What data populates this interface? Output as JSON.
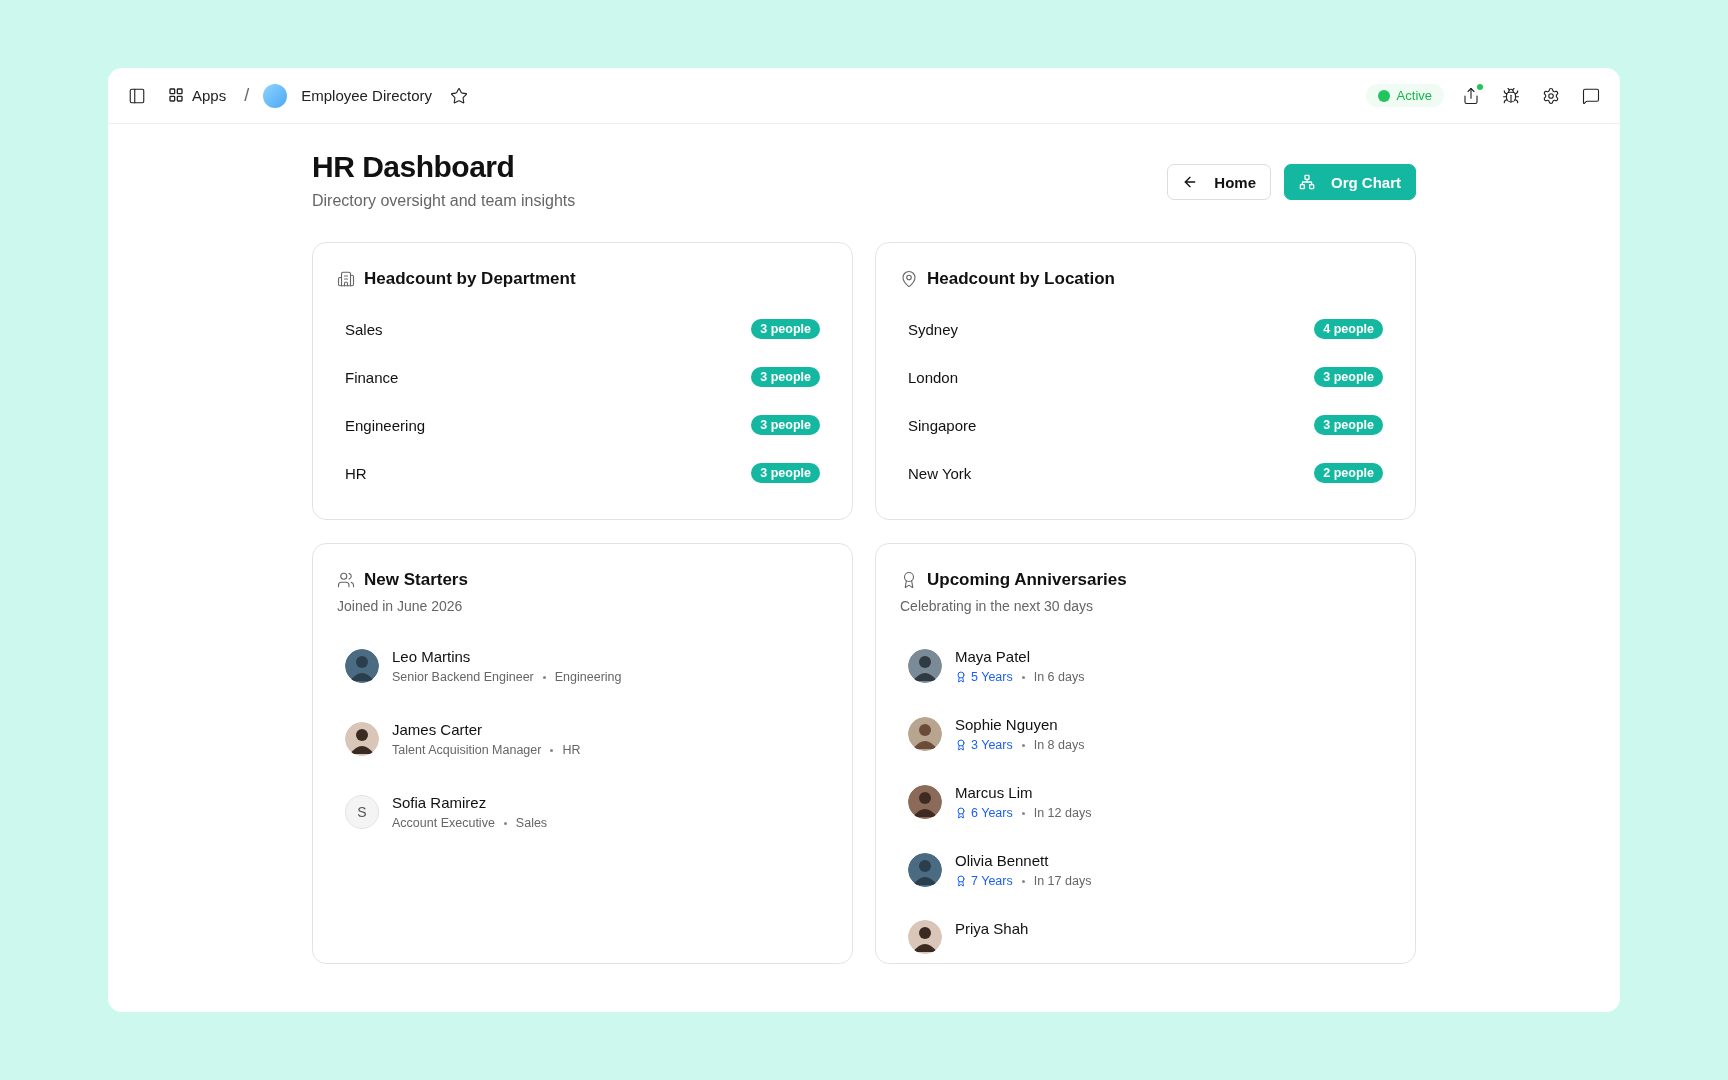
{
  "topbar": {
    "apps_label": "Apps",
    "breadcrumb_separator": "/",
    "app_name": "Employee Directory",
    "favorite": false,
    "status": "Active"
  },
  "header": {
    "title": "HR Dashboard",
    "subtitle": "Directory oversight and team insights",
    "buttons": [
      {
        "kind": "back",
        "label": "Home"
      },
      {
        "kind": "primary",
        "label": "Org Chart"
      }
    ]
  },
  "department_card": {
    "title": "Headcount by Department",
    "rows": [
      {
        "name": "Sales",
        "count": "3 people"
      },
      {
        "name": "Finance",
        "count": "3 people"
      },
      {
        "name": "Engineering",
        "count": "3 people"
      },
      {
        "name": "HR",
        "count": "3 people"
      }
    ]
  },
  "location_card": {
    "title": "Headcount by Location",
    "rows": [
      {
        "name": "Sydney",
        "count": "4 people"
      },
      {
        "name": "London",
        "count": "3 people"
      },
      {
        "name": "Singapore",
        "count": "3 people"
      },
      {
        "name": "New York",
        "count": "2 people"
      }
    ]
  },
  "new_starters": {
    "title": "New Starters",
    "subtitle": "Joined in June 2026",
    "people": [
      {
        "name": "Leo Martins",
        "role": "Senior Backend Engineer",
        "department": "Engineering",
        "avatar": {
          "kind": "photo"
        }
      },
      {
        "name": "James Carter",
        "role": "Talent Acquisition Manager",
        "department": "HR",
        "avatar": {
          "kind": "photo"
        }
      },
      {
        "name": "Sofia Ramirez",
        "role": "Account Executive",
        "department": "Sales",
        "avatar": {
          "kind": "initial",
          "initial": "S"
        }
      }
    ]
  },
  "anniversaries": {
    "title": "Upcoming Anniversaries",
    "subtitle": "Celebrating in the next 30 days",
    "people": [
      {
        "name": "Maya Patel",
        "years": "5 Years",
        "when": "In 6 days"
      },
      {
        "name": "Sophie Nguyen",
        "years": "3 Years",
        "when": "In 8 days"
      },
      {
        "name": "Marcus Lim",
        "years": "6 Years",
        "when": "In 12 days"
      },
      {
        "name": "Olivia Bennett",
        "years": "7 Years",
        "when": "In 17 days"
      },
      {
        "name": "Priya Shah"
      }
    ]
  }
}
